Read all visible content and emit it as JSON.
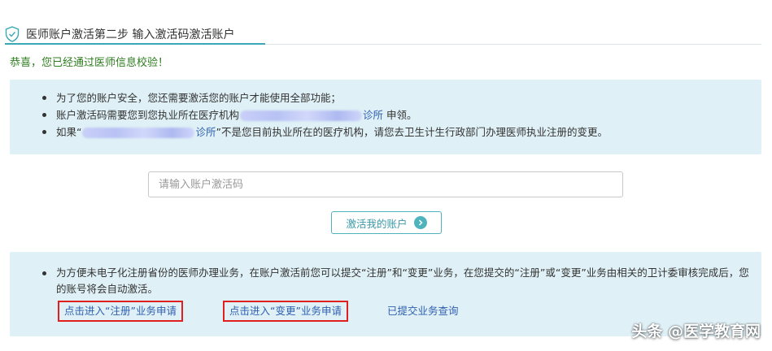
{
  "header": {
    "title": "医师账户激活第二步 输入激活码激活账户"
  },
  "success_message": "恭喜，您已经通过医师信息校验！",
  "info": {
    "item1": "为了您的账户安全，您还需要激活您的账户才能使用全部功能；",
    "item2_prefix": "账户激活码需要您到您执业所在医疗机构",
    "item2_institution_suffix": "诊所",
    "item2_suffix": "申领。",
    "item3_prefix": "如果“",
    "item3_institution_suffix": "诊所",
    "item3_suffix": "”不是您目前执业所在的医疗机构，请您去卫生计生行政部门办理医师执业注册的变更。"
  },
  "activation": {
    "placeholder": "请输入账户激活码",
    "value": "",
    "button_label": "激活我的账户"
  },
  "notice": {
    "text": "为方便未电子化注册省份的医师办理业务，在账户激活前您可以提交“注册”和“变更”业务，在您提交的“注册”或“变更”业务由相关的卫计委审核完成后，您的账号将会自动激活。",
    "links": {
      "register": "点击进入“注册”业务申请",
      "change": "点击进入“变更”业务申请",
      "query": "已提交业务查询"
    }
  },
  "watermark": "头条 @医学教育网",
  "colors": {
    "accent": "#3aa9b4",
    "success": "#2e7d1e",
    "link": "#2f5fb0",
    "info_bg": "#dff0f6",
    "highlight_frame": "#e02020"
  }
}
